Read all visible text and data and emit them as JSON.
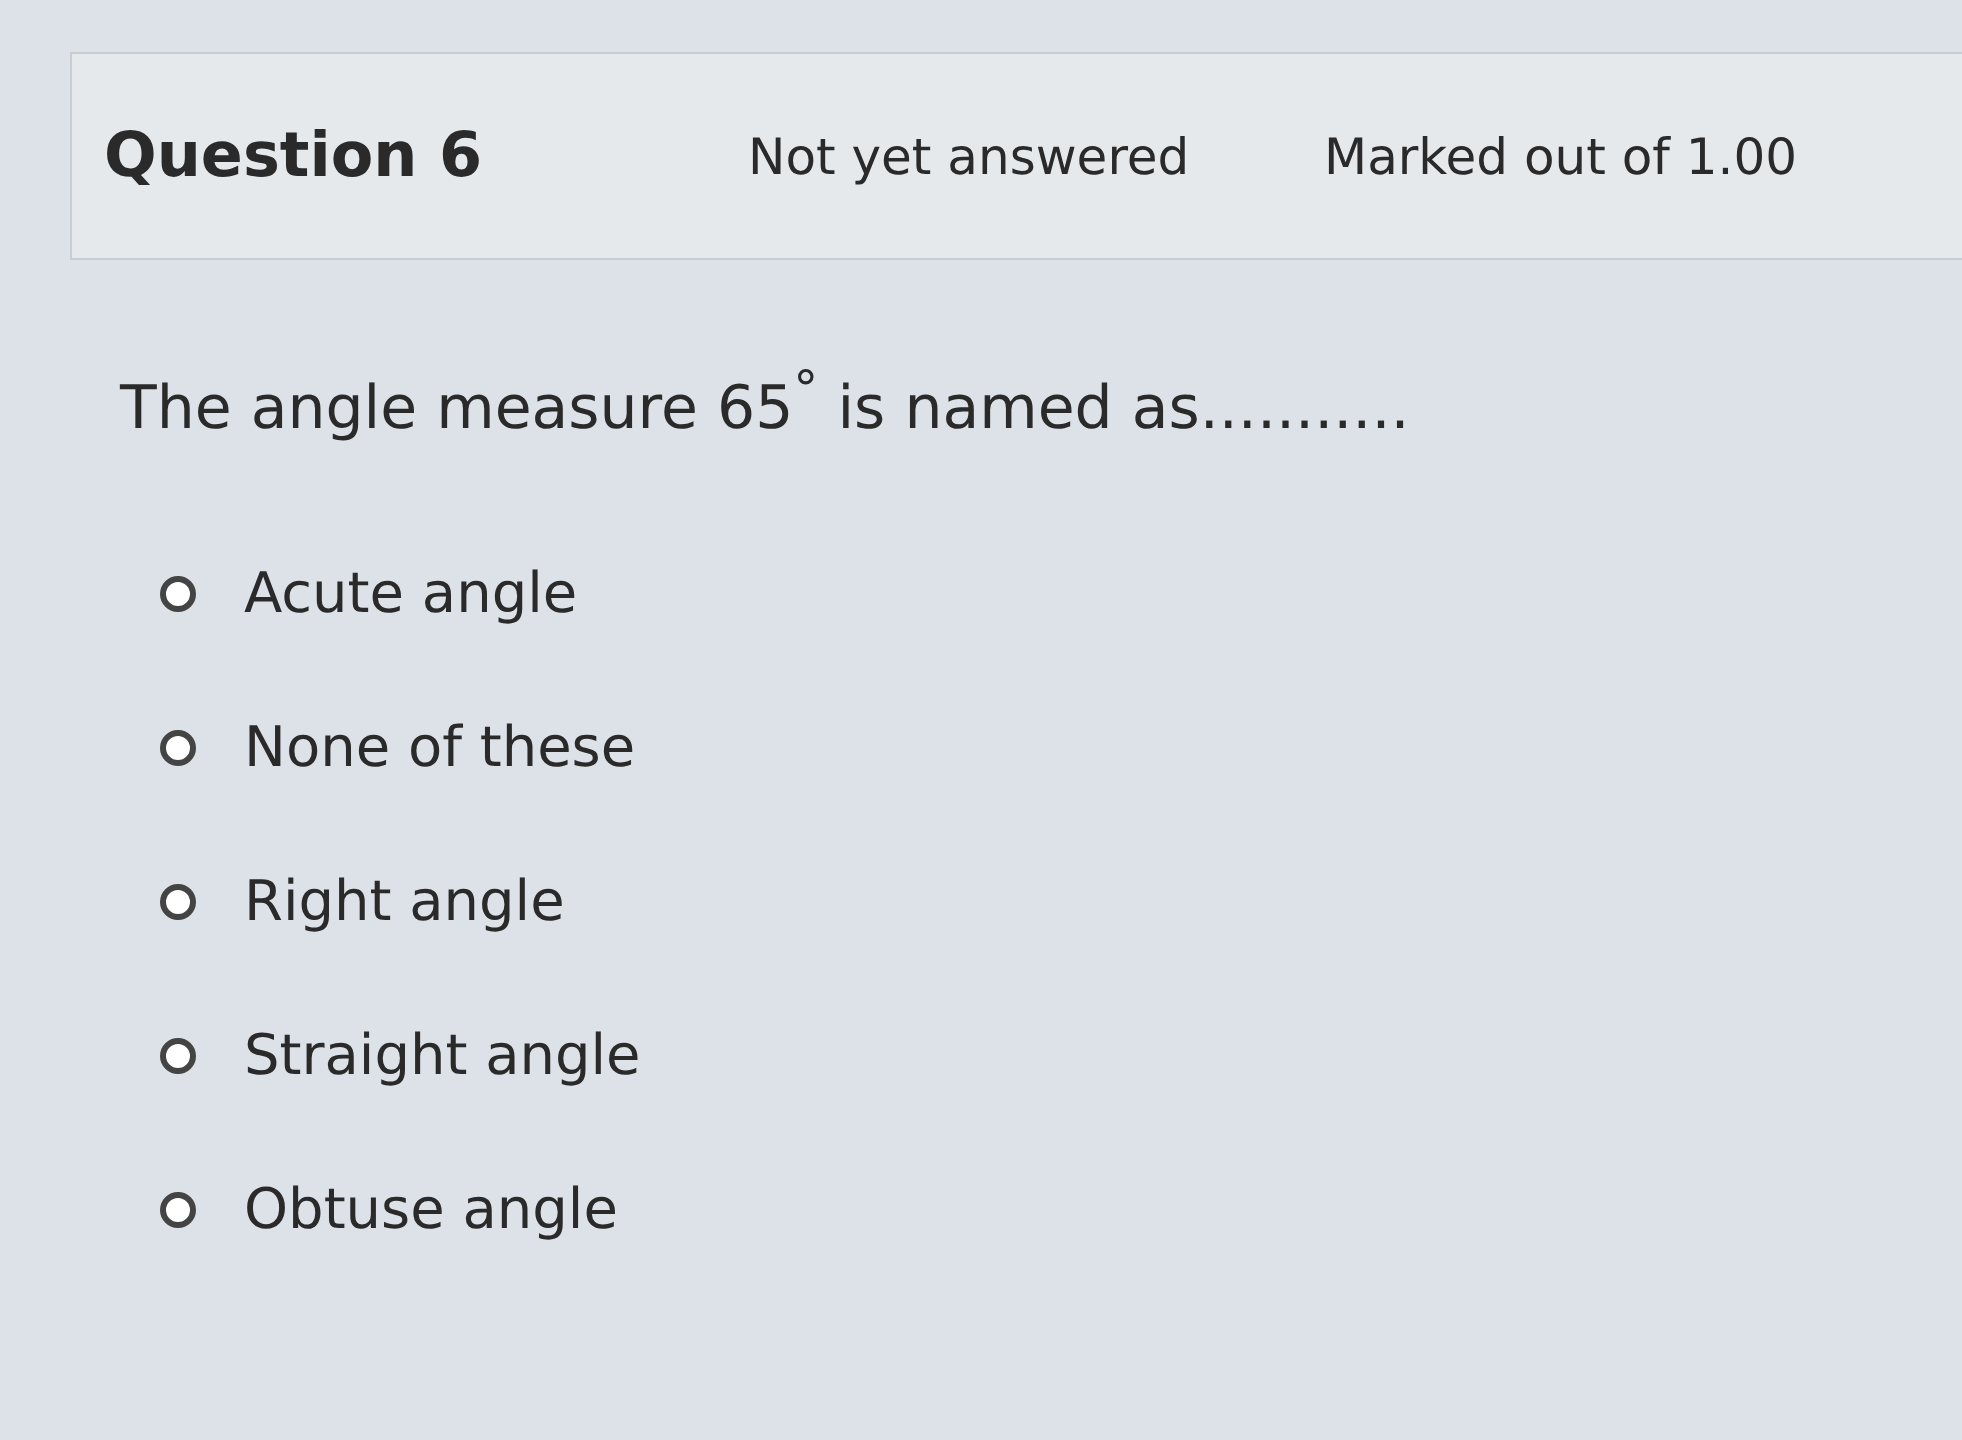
{
  "question_info": {
    "title": "Question 6",
    "status": "Not yet answered",
    "mark": "Marked out of 1.00"
  },
  "question": {
    "text": "The angle measure 65$^{°}$ is named as...........",
    "options": [
      {
        "label": "Acute angle",
        "selected": false
      },
      {
        "label": "None of these",
        "selected": false
      },
      {
        "label": "Right angle",
        "selected": false
      },
      {
        "label": "Straight angle",
        "selected": false
      },
      {
        "label": "Obtuse angle",
        "selected": false
      }
    ]
  }
}
